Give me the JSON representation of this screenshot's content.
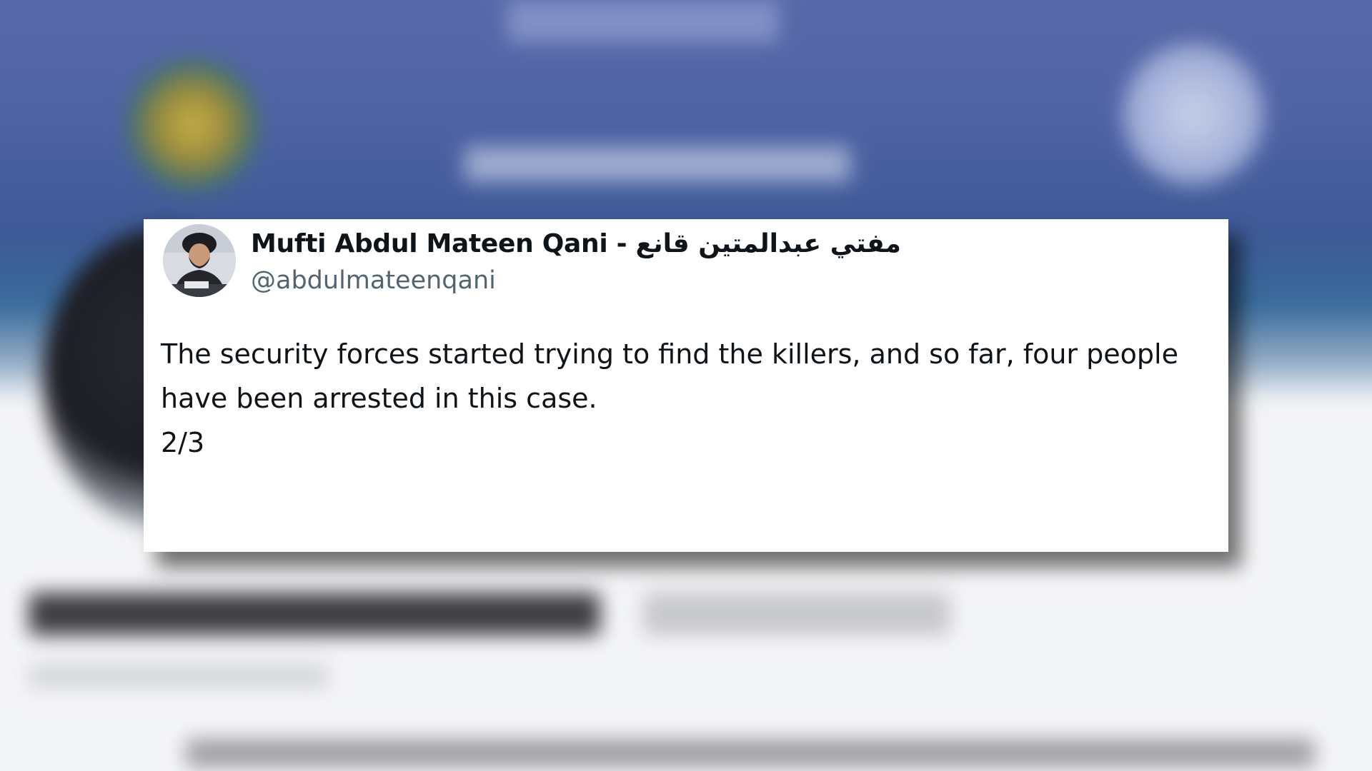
{
  "tweet": {
    "display_name": "Mufti Abdul Mateen Qani - مفتي عبدالمتين قانع",
    "handle": "@abdulmateenqani",
    "text_lines": [
      "The security forces started trying to find the killers, and so far, four people",
      "have been arrested in this case.",
      "2/3"
    ],
    "avatar_icon": "profile-photo"
  },
  "colors": {
    "card_background": "#ffffff",
    "text_primary": "#0f1419",
    "text_secondary": "#536471",
    "banner_blue": "#4e62a4"
  }
}
